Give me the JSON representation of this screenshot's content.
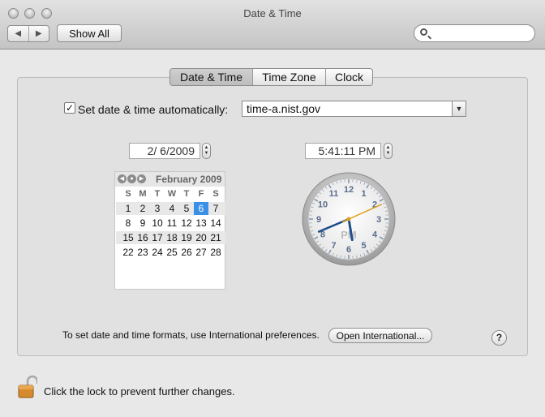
{
  "window": {
    "title": "Date & Time"
  },
  "toolbar": {
    "back_icon": "◀",
    "forward_icon": "▶",
    "show_all_label": "Show All",
    "search": {
      "value": "",
      "placeholder": ""
    }
  },
  "tabs": [
    {
      "label": "Date & Time",
      "selected": true
    },
    {
      "label": "Time Zone",
      "selected": false
    },
    {
      "label": "Clock",
      "selected": false
    }
  ],
  "auto": {
    "checked": true,
    "check_mark": "✓",
    "label": "Set date & time automatically:",
    "server": "time-a.nist.gov",
    "dropdown_icon": "▼"
  },
  "date_field": {
    "value": "2/ 6/2009"
  },
  "time_field": {
    "value": "5:41:11 PM"
  },
  "stepper": {
    "up": "▲",
    "down": "▼"
  },
  "calendar": {
    "prev_icon": "◀",
    "today_icon": "●",
    "next_icon": "▶",
    "month_label": "February 2009",
    "weekdays": [
      "S",
      "M",
      "T",
      "W",
      "T",
      "F",
      "S"
    ],
    "weeks": [
      [
        "1",
        "2",
        "3",
        "4",
        "5",
        "6",
        "7"
      ],
      [
        "8",
        "9",
        "10",
        "11",
        "12",
        "13",
        "14"
      ],
      [
        "15",
        "16",
        "17",
        "18",
        "19",
        "20",
        "21"
      ],
      [
        "22",
        "23",
        "24",
        "25",
        "26",
        "27",
        "28"
      ]
    ],
    "selected_day": "6"
  },
  "clock": {
    "numbers": [
      "12",
      "1",
      "2",
      "3",
      "4",
      "5",
      "6",
      "7",
      "8",
      "9",
      "10",
      "11"
    ],
    "ampm": "PM",
    "time": {
      "hours": 5,
      "minutes": 41,
      "seconds": 11
    },
    "hand_color": "#1f4e8c",
    "second_hand_color": "#e0a020"
  },
  "footer": {
    "formats_text": "To set date and time formats, use International preferences.",
    "open_international_label": "Open International...",
    "help_label": "?",
    "lock_text": "Click the lock to prevent further changes."
  },
  "colors": {
    "selection": "#3a8fe6"
  }
}
